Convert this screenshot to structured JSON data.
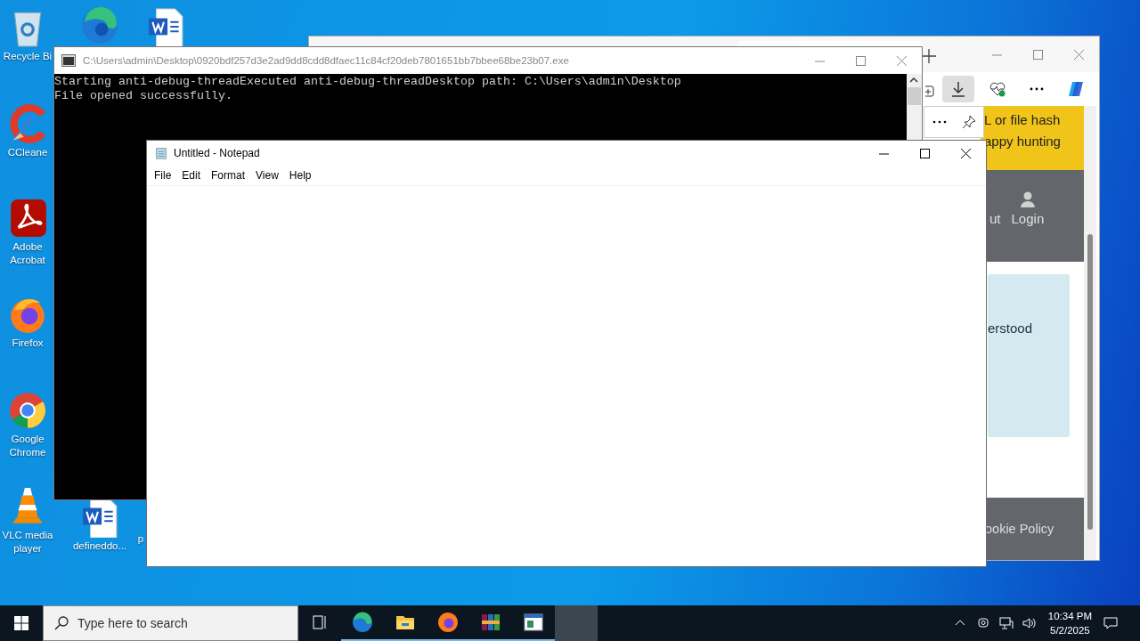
{
  "desktop_icons": [
    {
      "kind": "recycle",
      "label": "Recycle Bi"
    },
    {
      "kind": "edge"
    },
    {
      "kind": "word"
    },
    {
      "kind": "ccleaner",
      "label": "CCleane"
    },
    {
      "kind": "acrobat",
      "label": "Adobe Acrobat"
    },
    {
      "kind": "firefox",
      "label": "Firefox"
    },
    {
      "kind": "chrome",
      "label": "Google Chrome"
    },
    {
      "kind": "vlc",
      "label": "VLC media player"
    },
    {
      "kind": "word",
      "label": "defineddo..."
    },
    {
      "kind": "none",
      "label": "p"
    }
  ],
  "browser": {
    "banner_lines": [
      "L or file hash",
      "appy hunting"
    ],
    "nav_items": [
      "ut",
      "Login"
    ],
    "card_text": "erstood",
    "footer_text": "ookie Policy"
  },
  "console": {
    "title": "C:\\Users\\admin\\Desktop\\0920bdf257d3e2ad9dd8cdd8dfaec11c84cf20deb7801651bb7bbee68be23b07.exe",
    "lines": [
      "Starting anti-debug-threadExecuted anti-debug-threadDesktop path: C:\\Users\\admin\\Desktop",
      "File opened successfully."
    ]
  },
  "notepad": {
    "title": "Untitled - Notepad",
    "menu": [
      "File",
      "Edit",
      "Format",
      "View",
      "Help"
    ]
  },
  "taskbar": {
    "search_placeholder": "Type here to search",
    "apps": [
      {
        "kind": "edge",
        "running": true,
        "selected": false
      },
      {
        "kind": "explorer",
        "running": true,
        "selected": false
      },
      {
        "kind": "firefox",
        "running": true,
        "selected": false
      },
      {
        "kind": "winrar",
        "running": true,
        "selected": false
      },
      {
        "kind": "window",
        "running": true,
        "selected": false
      },
      {
        "kind": "blank",
        "running": false,
        "selected": true
      }
    ],
    "time": "10:34 PM",
    "date": "5/2/2025"
  }
}
